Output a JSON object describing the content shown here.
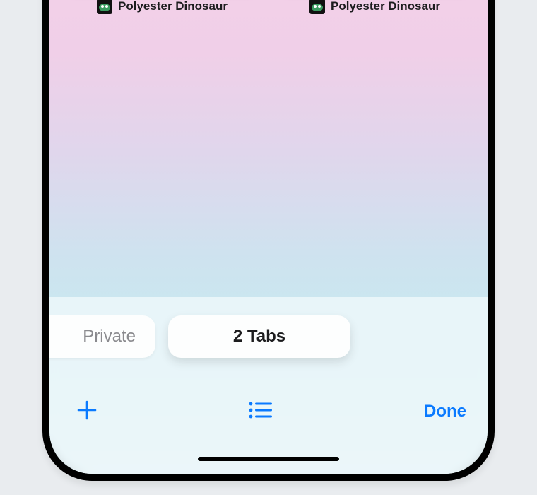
{
  "tabs": [
    {
      "title": "Polyester Dinosaur",
      "favicon": "dinosaur-icon"
    },
    {
      "title": "Polyester Dinosaur",
      "favicon": "dinosaur-icon"
    }
  ],
  "tab_groups": {
    "private_label": "Private",
    "active_label": "2 Tabs"
  },
  "toolbar": {
    "done_label": "Done"
  },
  "colors": {
    "tint": "#0a7aff"
  }
}
